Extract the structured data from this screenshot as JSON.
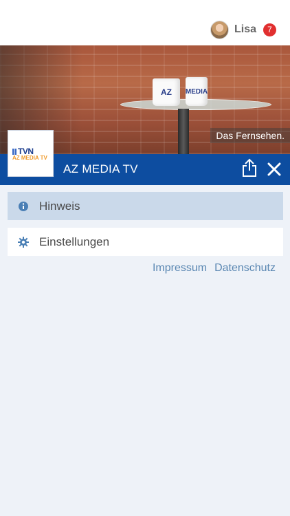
{
  "header": {
    "user_name": "Lisa",
    "notification_count": "7"
  },
  "hero": {
    "mug_text_1": "AZ",
    "mug_text_2": "MEDIA",
    "caption": "Das Fernsehen."
  },
  "station": {
    "logo_line1": "TVN",
    "logo_line2": "AZ MEDIA TV",
    "title": "AZ MEDIA TV",
    "share_icon": "share-icon",
    "close_icon": "close-icon"
  },
  "menu": {
    "items": [
      {
        "label": "Hinweis",
        "icon": "info-icon",
        "selected": true
      },
      {
        "label": "Einstellungen",
        "icon": "gear-icon",
        "selected": false
      }
    ]
  },
  "footer_links": {
    "impressum": "Impressum",
    "datenschutz": "Datenschutz"
  },
  "colors": {
    "station_bar": "#0d4da0",
    "selected_item": "#cad9ea",
    "background": "#eef2f8",
    "link": "#5a87b2",
    "badge": "#e12f2f"
  }
}
